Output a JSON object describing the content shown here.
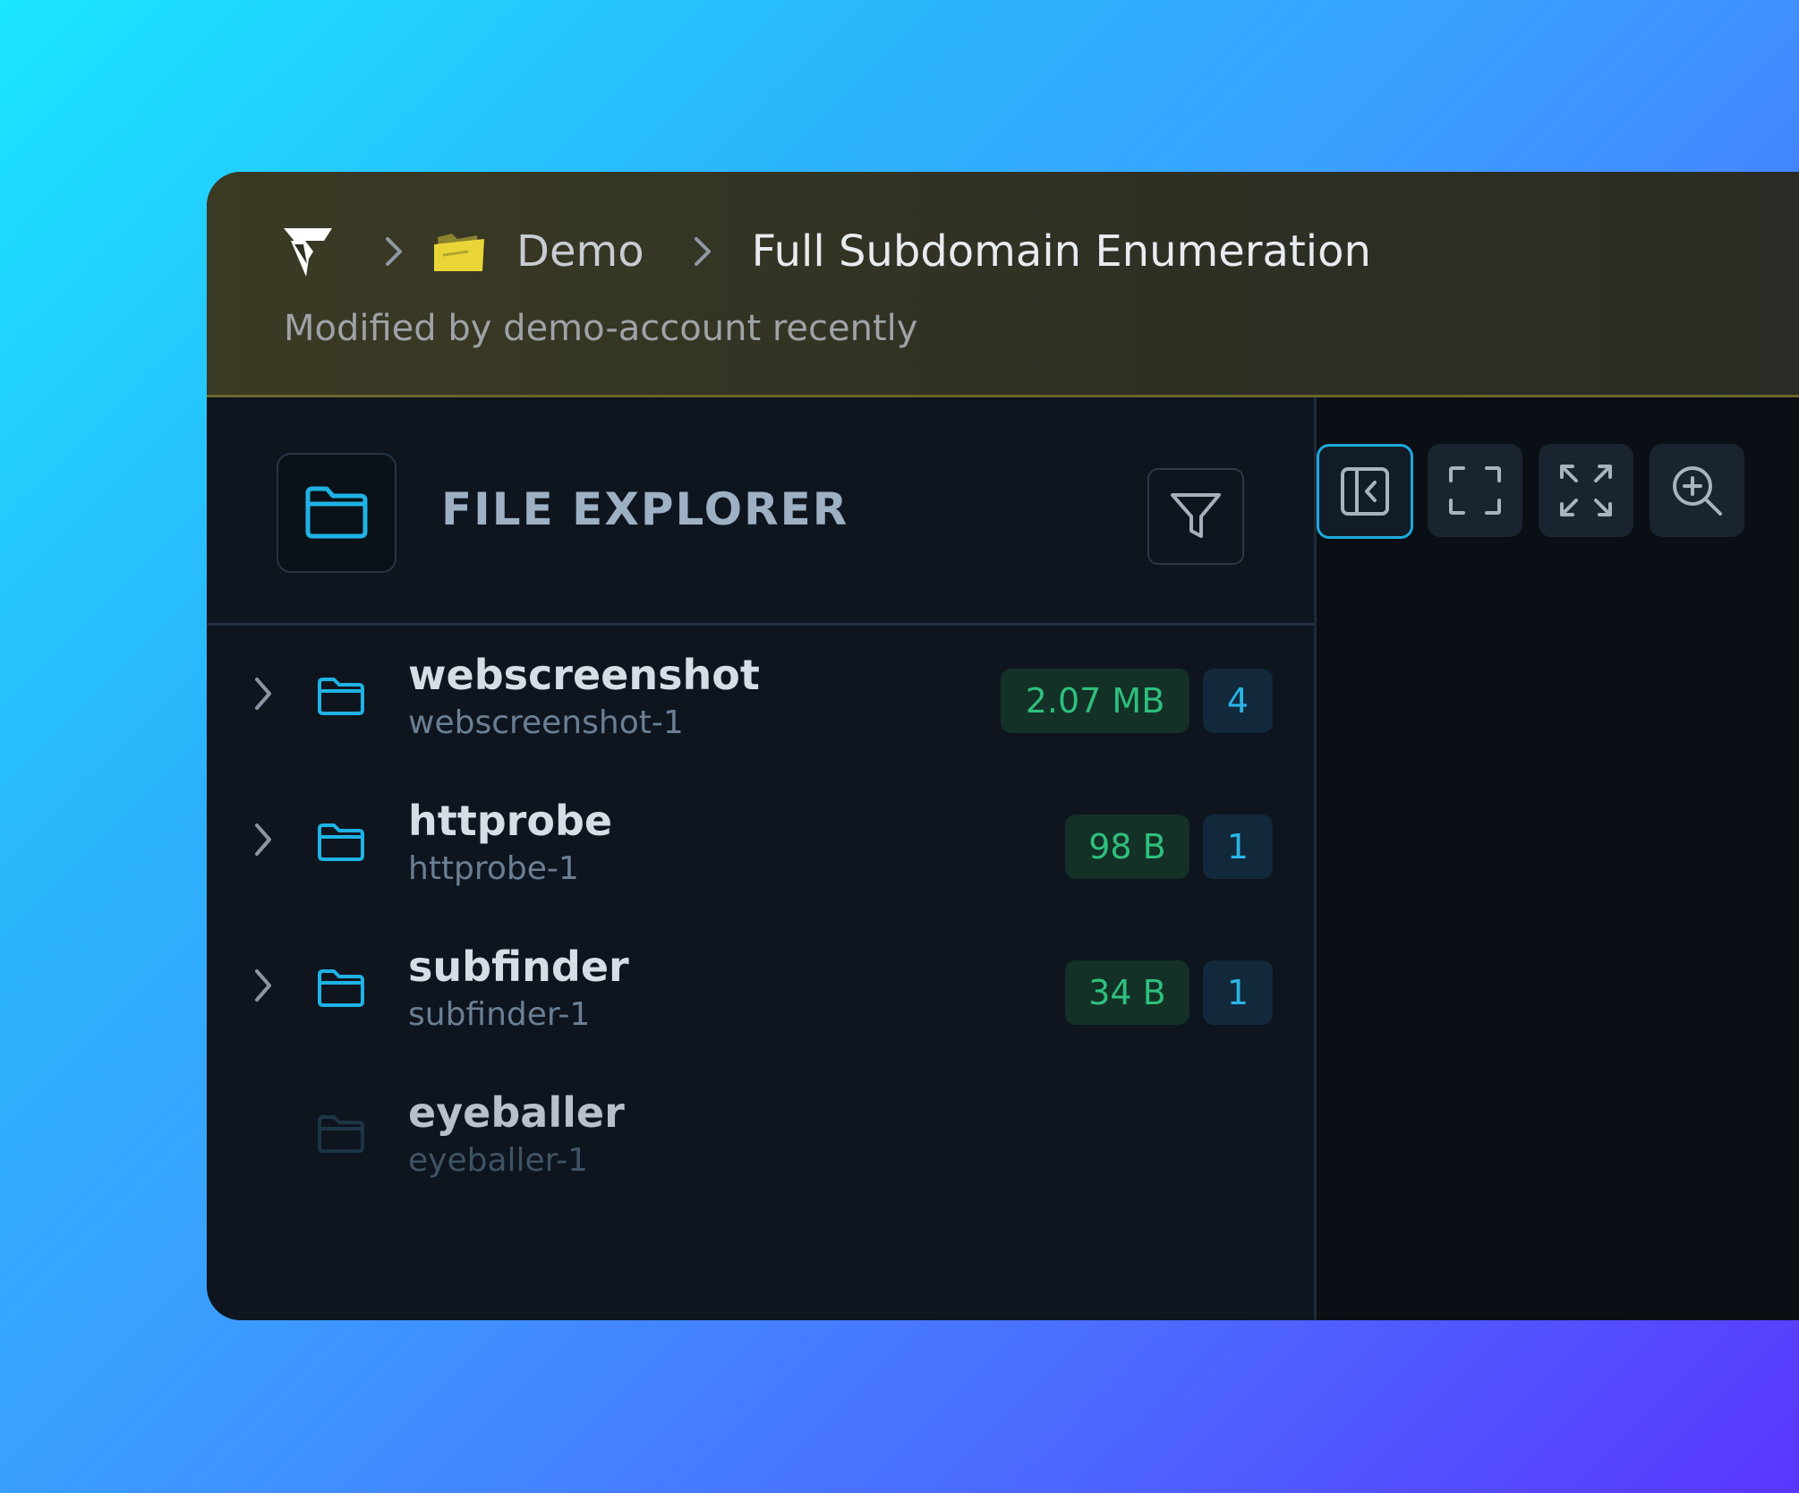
{
  "colors": {
    "accent": "#1ea9dc",
    "size_badge": "#2fbf7c",
    "count_badge": "#2bb4e6",
    "folder_icon": "#1fb2e4",
    "project_folder": "#e6d23a"
  },
  "breadcrumb": {
    "logo_icon": "brand-logo-icon",
    "project": "Demo",
    "project_icon": "folder-yellow-icon",
    "page": "Full Subdomain Enumeration"
  },
  "header": {
    "subtitle": "Modified by demo-account recently"
  },
  "explorer": {
    "title": "FILE EXPLORER",
    "icon": "folder-icon",
    "filter_icon": "filter-icon",
    "items": [
      {
        "name": "webscreenshot",
        "sub": "webscreenshot-1",
        "size": "2.07 MB",
        "count": "4",
        "expandable": true
      },
      {
        "name": "httprobe",
        "sub": "httprobe-1",
        "size": "98 B",
        "count": "1",
        "expandable": true
      },
      {
        "name": "subfinder",
        "sub": "subfinder-1",
        "size": "34 B",
        "count": "1",
        "expandable": true
      },
      {
        "name": "eyeballer",
        "sub": "eyeballer-1",
        "expandable": false
      }
    ]
  },
  "toolbar": {
    "buttons": [
      {
        "icon": "collapse-panel-icon",
        "active": true
      },
      {
        "icon": "fit-screen-icon",
        "active": false
      },
      {
        "icon": "expand-icon",
        "active": false
      },
      {
        "icon": "zoom-in-icon",
        "active": false
      }
    ]
  }
}
